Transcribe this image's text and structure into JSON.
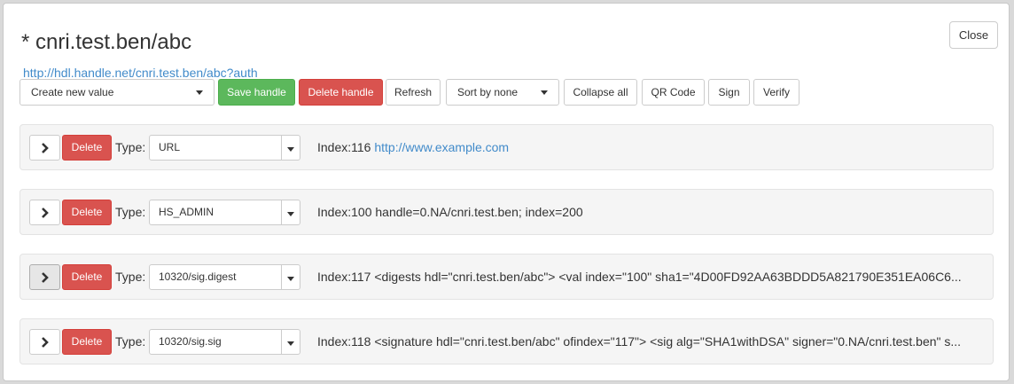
{
  "title": "* cnri.test.ben/abc",
  "handle_url": "http://hdl.handle.net/cnri.test.ben/abc?auth",
  "close_label": "Close",
  "toolbar": {
    "create_select": "Create new value",
    "save": "Save handle",
    "delete": "Delete handle",
    "refresh": "Refresh",
    "sort_select": "Sort by none",
    "collapse": "Collapse all",
    "qr": "QR Code",
    "sign": "Sign",
    "verify": "Verify"
  },
  "type_label": "Type:",
  "delete_label": "Delete",
  "rows": [
    {
      "type": "URL",
      "index_text": "Index:116",
      "value": "http://www.example.com",
      "is_link": true
    },
    {
      "type": "HS_ADMIN",
      "index_text": "Index:100",
      "value": "handle=0.NA/cnri.test.ben; index=200",
      "is_link": false
    },
    {
      "type": "10320/sig.digest",
      "index_text": "Index:117",
      "value": "<digests hdl=\"cnri.test.ben/abc\"> <val index=\"100\" sha1=\"4D00FD92AA63BDDD5A821790E351EA06C6...",
      "is_link": false
    },
    {
      "type": "10320/sig.sig",
      "index_text": "Index:118",
      "value": "<signature hdl=\"cnri.test.ben/abc\" ofindex=\"117\"> <sig alg=\"SHA1withDSA\" signer=\"0.NA/cnri.test.ben\" s...",
      "is_link": false
    }
  ]
}
